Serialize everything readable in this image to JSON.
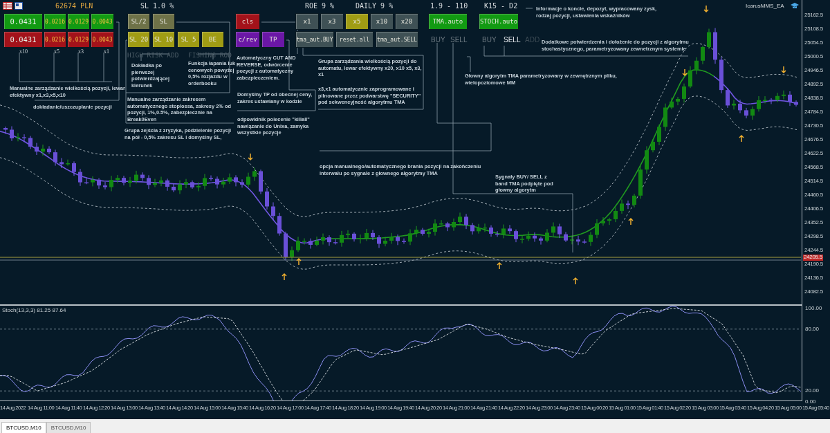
{
  "account": {
    "balance": "62674 PLN"
  },
  "lot_panel": {
    "buy_row": [
      "0.0431",
      "0.0216",
      "0.0129",
      "0.0043"
    ],
    "sell_row": [
      "0.0431",
      "0.0216",
      "0.0129",
      "0.0043"
    ],
    "multipliers": [
      "x10",
      "x5",
      "x3",
      "x1"
    ]
  },
  "sl_panel": {
    "title": "SL 1.0 %",
    "buttons": [
      {
        "label": "SL/2",
        "kind": "split"
      },
      {
        "label": "SL",
        "kind": "split"
      },
      {
        "label": "SL 20",
        "kind": "level"
      },
      {
        "label": "SL 10",
        "kind": "level"
      },
      {
        "label": "SL 5",
        "kind": "level"
      },
      {
        "label": "BE",
        "kind": "level"
      }
    ],
    "options": [
      {
        "label": "HIGH RISK ADD",
        "enabled": false
      },
      {
        "label": "FISHING ROD",
        "enabled": false
      }
    ]
  },
  "close_panel": {
    "buttons": [
      {
        "label": "cls",
        "kind": "close"
      },
      {
        "label": "c/rev",
        "kind": "reverse"
      },
      {
        "label": "TP",
        "kind": "reverse"
      }
    ]
  },
  "auto_panel": {
    "roe": "ROE 9 %",
    "daily": "DAILY 9 %",
    "multipliers": [
      {
        "label": "x1",
        "selected": false
      },
      {
        "label": "x3",
        "selected": false
      },
      {
        "label": "x5",
        "selected": true
      },
      {
        "label": "x10",
        "selected": false
      },
      {
        "label": "x20",
        "selected": false
      }
    ],
    "actions": [
      "tma_aut.BUY",
      "reset.all",
      "tma_aut.SELL"
    ]
  },
  "tma": {
    "setting": "1.9 - 110",
    "button": "TMA.auto",
    "signals": [
      {
        "label": "BUY",
        "active": false,
        "disabled": false
      },
      {
        "label": "SELL",
        "active": false,
        "disabled": false
      }
    ]
  },
  "stoch": {
    "setting": "K15 - D2",
    "button": "STOCH.auto",
    "signals": [
      {
        "label": "BUY",
        "active": false,
        "disabled": false
      },
      {
        "label": "SELL",
        "active": true
      },
      {
        "label": "ADD",
        "disabled": true
      }
    ]
  },
  "annotations": [
    "Manualne zarządzanie wielkością pozycji, lewar efektywny x1,x3,x5,x10",
    "dokładanie/uszczuplanie pozycji",
    "Dokładka po pierwszej potwierdzającej kierunek",
    "Funkcja łapania luk cenowych powyżej 0,5% rozjazdu w orderbooku",
    "Manualne zarządzanie zakresem automatycznego stoplossa, zakresy 2% od pozycji, 1%,0.5%, zabezpiecznie na Break0Even",
    "Grupa zejścia z zryzyka, podzielenie pozycji na pół - 0,5% zakresu SL i domyślny SL,",
    "Automatyczny CUT AND REVERSE, odwórcenie pozycji z automatyczny zabezpieczeniem.",
    "Domyśłny TP od obecnej ceny, zakres ustawiany w kodzie",
    "odpowidnik polecenie \"killall\" nawiązanie do Unixa, zamyka wszystkie pozycje",
    "Grupa zarządzania wielkością pozycji do automatu, lewar efektywny x20, x10 x5, x3, x1",
    "x3,x1 automatycznie zaprogramowane i pilnowane przez podwarstwę \"SECURITY\" pod sekwencyjność algorytmu TMA",
    "opcja manualnego/automatycznego brania pozycji na zakończeniu interwału po sygnale z głownego algorytmy TMA",
    "Sygnały BUY/ SELL z band TMA podpięte pod głowny algorytm",
    "Głowny algorytm TMA parametryzowany w zewnętrznym pliku, wielopoziomowe MM",
    "Informacje o koncie, depozyt, wypracowany zysk, rodzaj pozycji, ustawienia wskaźników",
    "Dodatkowe potwierdzenia i dołożenie do pozycji z algorytmu stochastycznego, parametryzowany zewnetrznym systemie"
  ],
  "expert": {
    "name": "IcarusMMS_EA"
  },
  "price_axis": {
    "labels": [
      "25162.5",
      "25108.5",
      "25054.5",
      "25000.5",
      "24946.5",
      "24892.5",
      "24838.5",
      "24784.5",
      "24730.5",
      "24676.5",
      "24622.5",
      "24568.5",
      "24514.5",
      "24460.5",
      "24406.5",
      "24352.5",
      "24298.5",
      "24244.5",
      "24190.5",
      "24136.5",
      "24082.5"
    ],
    "current_price": "24205.5"
  },
  "indicator": {
    "title": "Stoch(13,3,3) 81.25 87.64",
    "levels": [
      "100.00",
      "80.00",
      "20.00",
      "0.00"
    ]
  },
  "time_axis": {
    "labels": [
      "14 Aug 2022",
      "14 Aug 11:00",
      "14 Aug 11:40",
      "14 Aug 12:20",
      "14 Aug 13:00",
      "14 Aug 13:40",
      "14 Aug 14:20",
      "14 Aug 15:00",
      "14 Aug 15:40",
      "14 Aug 16:20",
      "14 Aug 17:00",
      "14 Aug 17:40",
      "14 Aug 18:20",
      "14 Aug 19:00",
      "14 Aug 19:40",
      "14 Aug 20:20",
      "14 Aug 21:00",
      "14 Aug 21:40",
      "14 Aug 22:20",
      "14 Aug 23:00",
      "14 Aug 23:40",
      "15 Aug 00:20",
      "15 Aug 01:00",
      "15 Aug 01:40",
      "15 Aug 02:20",
      "15 Aug 03:00",
      "15 Aug 03:40",
      "15 Aug 04:20",
      "15 Aug 05:00",
      "15 Aug 05:40"
    ]
  },
  "tabs": [
    {
      "label": "BTCUSD,M10",
      "selected": true
    },
    {
      "label": "BTCUSD,M10",
      "selected": false
    }
  ]
}
